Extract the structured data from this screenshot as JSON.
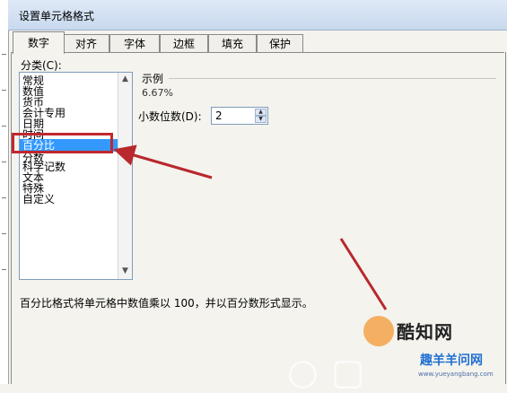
{
  "dialog": {
    "title": "设置单元格格式"
  },
  "tabs": [
    "数字",
    "对齐",
    "字体",
    "边框",
    "填充",
    "保护"
  ],
  "category": {
    "label": "分类(C):",
    "items": [
      "常规",
      "数值",
      "货币",
      "会计专用",
      "日期",
      "时间",
      "百分比",
      "分数",
      "科学记数",
      "文本",
      "特殊",
      "自定义"
    ],
    "selected_index": 6
  },
  "sample": {
    "label": "示例",
    "value": "6.67%"
  },
  "decimal_places": {
    "label": "小数位数(D):",
    "value": "2"
  },
  "description": "百分比格式将单元格中数值乘以 100，并以百分数形式显示。",
  "watermark": {
    "name": "酷知网",
    "name2": "趣羊羊问网",
    "url": "www.yueyangbang.com"
  },
  "colors": {
    "highlight": "#c0282d",
    "selection": "#3399ff",
    "arrow": "#b8282d"
  }
}
